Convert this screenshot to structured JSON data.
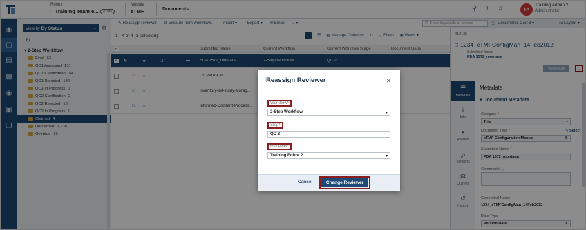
{
  "topbar": {
    "room_label": "Room",
    "room_value": "Training Team e...",
    "room_pill": "eTMF",
    "module_label": "Module",
    "module_value": "eTMF",
    "docs_label": "Documents",
    "user_initials": "TA",
    "user_name": "Training Admin 2",
    "user_role": "Administrator"
  },
  "nav": {
    "viewby_prefix": "View by",
    "viewby_value": "By Status",
    "workflow_title": "2-Step Workflow",
    "items": [
      {
        "label": "Final",
        "count": "63"
      },
      {
        "label": "QC1 Approved",
        "count": "131"
      },
      {
        "label": "QC1 Clarification",
        "count": "14"
      },
      {
        "label": "QC1 Rejected",
        "count": "132"
      },
      {
        "label": "QC1 In Progress",
        "count": "0"
      },
      {
        "label": "QC2 Clarification",
        "count": "2"
      },
      {
        "label": "QC2 Rejected",
        "count": "13"
      },
      {
        "label": "QC2 In Progress",
        "count": "1"
      },
      {
        "label": "Claimed",
        "count": "4"
      },
      {
        "label": "Unclaimed",
        "count": "1,738"
      },
      {
        "label": "Overdue",
        "count": "19"
      }
    ]
  },
  "toolbar": {
    "reassign": "Reassign reviewer",
    "exclude": "Exclude from workflows",
    "import": "Import",
    "export": "Export",
    "email": "Email",
    "more": "...",
    "search_placeholder": "Enter keywords or phrase",
    "cart": "Documents Cart",
    "cart_count": "8",
    "layout": "Layout"
  },
  "list": {
    "summary": "1 - 4 of 4 (1 selected)",
    "manage_columns": "Manage Columns",
    "filters": "Filters",
    "views": "Views",
    "columns": [
      "Submitted Name",
      "Current Workflow",
      "Current Workflow Stage",
      "Document Issue"
    ],
    "rows": [
      {
        "name": "FDA 1572_montana",
        "workflow": "2-Step Workflow",
        "stage": "QC 2",
        "issue": ""
      },
      {
        "name": "Dr. Parik-CV",
        "workflow": "",
        "stage": "",
        "issue": ""
      },
      {
        "name": "inventory-list-study-storag...",
        "workflow": "",
        "stage": "",
        "issue": ""
      },
      {
        "name": "Informed-Consent-Process...",
        "workflow": "",
        "stage": "",
        "issue": ""
      }
    ]
  },
  "modal": {
    "title": "Reassign Reviewer",
    "workflow_label": "Workflow",
    "workflow_value": "2-Step Workflow",
    "step_label": "Step",
    "step_value": "QC 2",
    "reviewer_label": "Reviewer",
    "reviewer_value": "Training Editor 2",
    "cancel": "Cancel",
    "submit": "Change Reviewer",
    "required_mark": "*"
  },
  "right_panel": {
    "doc_id": "212135",
    "doc_name": "1234_eTMFConfigMan_14Feb2012",
    "submitted_label": "Submitted Name",
    "submitted_value": "FDA 1572_montana",
    "release": "Release",
    "more": "...",
    "tabs": [
      "Metadata",
      "Info",
      "Related",
      "Versions",
      "Queries",
      "History"
    ],
    "heading": "Metadata",
    "section": "Document Metadata",
    "fields": {
      "category_label": "Category",
      "category_value": "Trial",
      "doctype_label": "Document Type",
      "doctype_value": "eTMF Configuration Manual",
      "select_link": "Select",
      "submitted_name_label": "Submitted Name",
      "submitted_name_value": "FDA 1572_montana",
      "comments_label": "Comments",
      "generated_label": "Generated Name",
      "generated_value": "1234_eTMFConfigMan_14Feb2012",
      "datetype_label": "Date Type",
      "datetype_value": "Version Date"
    }
  },
  "colors": {
    "primary": "#1d4a75",
    "highlight": "#8b1e1e",
    "avatar": "#d43b3b",
    "folder": "#d5a641"
  }
}
